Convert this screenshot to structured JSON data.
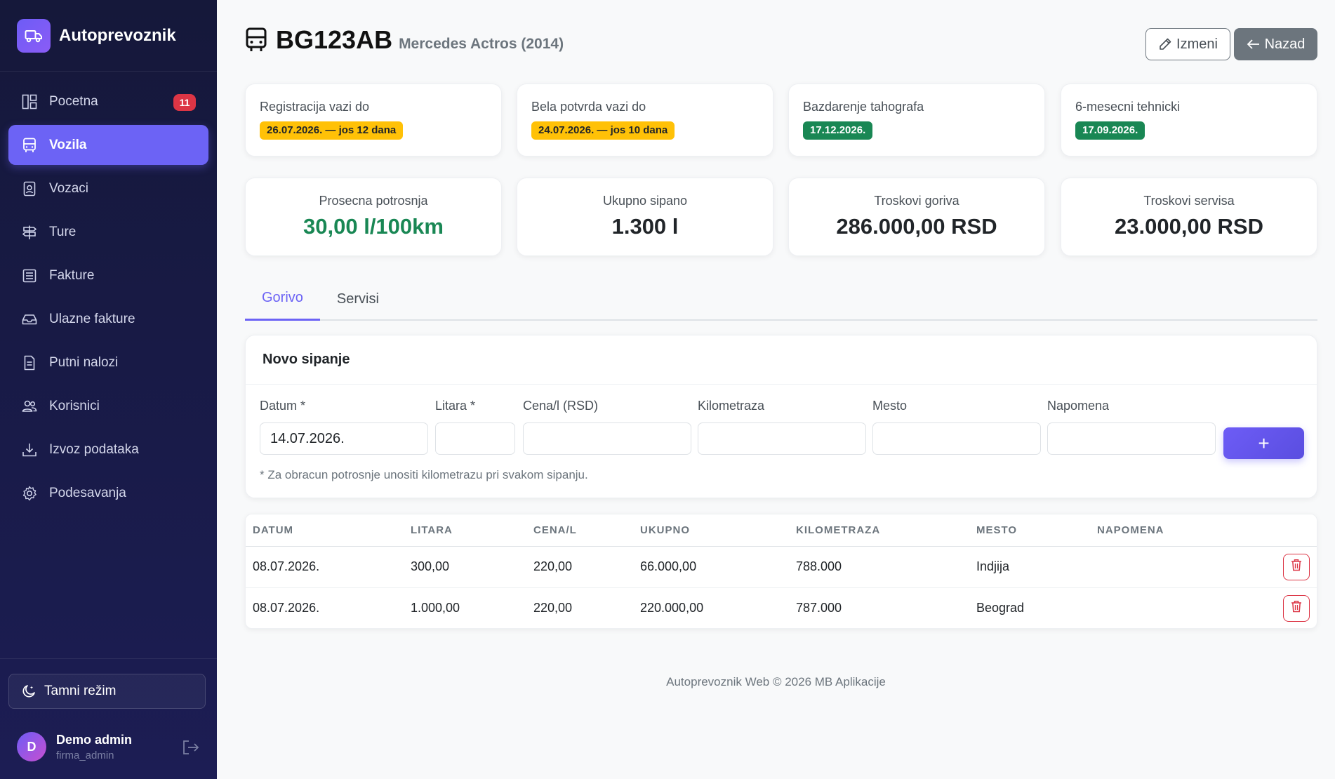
{
  "sidebar": {
    "brand": "Autoprevoznik",
    "items": [
      {
        "label": "Pocetna",
        "icon": "dashboard-icon",
        "badge": "11"
      },
      {
        "label": "Vozila",
        "icon": "bus-icon",
        "active": true
      },
      {
        "label": "Vozaci",
        "icon": "person-badge-icon"
      },
      {
        "label": "Ture",
        "icon": "signpost-icon"
      },
      {
        "label": "Fakture",
        "icon": "receipt-icon"
      },
      {
        "label": "Ulazne fakture",
        "icon": "inbox-icon"
      },
      {
        "label": "Putni nalozi",
        "icon": "document-icon"
      },
      {
        "label": "Korisnici",
        "icon": "people-icon"
      },
      {
        "label": "Izvoz podataka",
        "icon": "download-icon"
      },
      {
        "label": "Podesavanja",
        "icon": "gear-icon"
      }
    ],
    "dark_mode_label": "Tamni režim",
    "user": {
      "initial": "D",
      "name": "Demo admin",
      "role": "firma_admin"
    }
  },
  "header": {
    "plate": "BG123AB",
    "model": "Mercedes Actros (2014)",
    "edit_label": "Izmeni",
    "back_label": "Nazad"
  },
  "date_cards": [
    {
      "label": "Registracija vazi do",
      "value": "26.07.2026. — jos 12 dana",
      "status": "warning"
    },
    {
      "label": "Bela potvrda vazi do",
      "value": "24.07.2026. — jos 10 dana",
      "status": "warning"
    },
    {
      "label": "Bazdarenje tahografa",
      "value": "17.12.2026.",
      "status": "ok"
    },
    {
      "label": "6-mesecni tehnicki",
      "value": "17.09.2026.",
      "status": "ok"
    }
  ],
  "stats": [
    {
      "label": "Prosecna potrosnja",
      "value": "30,00 l/100km",
      "highlight": true
    },
    {
      "label": "Ukupno sipano",
      "value": "1.300 l"
    },
    {
      "label": "Troskovi goriva",
      "value": "286.000,00 RSD"
    },
    {
      "label": "Troskovi servisa",
      "value": "23.000,00 RSD"
    }
  ],
  "tabs": [
    {
      "label": "Gorivo",
      "active": true
    },
    {
      "label": "Servisi"
    }
  ],
  "form": {
    "title": "Novo sipanje",
    "fields": [
      {
        "label": "Datum *",
        "value": "14.07.2026."
      },
      {
        "label": "Litara *",
        "value": ""
      },
      {
        "label": "Cena/l (RSD)",
        "value": ""
      },
      {
        "label": "Kilometraza",
        "value": ""
      },
      {
        "label": "Mesto",
        "value": ""
      },
      {
        "label": "Napomena",
        "value": ""
      }
    ],
    "add_label": "+",
    "note": "* Za obracun potrosnje unositi kilometrazu pri svakom sipanju."
  },
  "table": {
    "columns": [
      "DATUM",
      "LITARA",
      "CENA/L",
      "UKUPNO",
      "KILOMETRAZA",
      "MESTO",
      "NAPOMENA"
    ],
    "rows": [
      [
        "08.07.2026.",
        "300,00",
        "220,00",
        "66.000,00",
        "788.000",
        "Indjija",
        ""
      ],
      [
        "08.07.2026.",
        "1.000,00",
        "220,00",
        "220.000,00",
        "787.000",
        "Beograd",
        ""
      ]
    ]
  },
  "footer": "Autoprevoznik Web © 2026 MB Aplikacije",
  "colors": {
    "accent": "#6c63f5",
    "sidebar_bg": "#15183a",
    "warning": "#ffc107",
    "success": "#198754",
    "danger": "#dc3545"
  }
}
